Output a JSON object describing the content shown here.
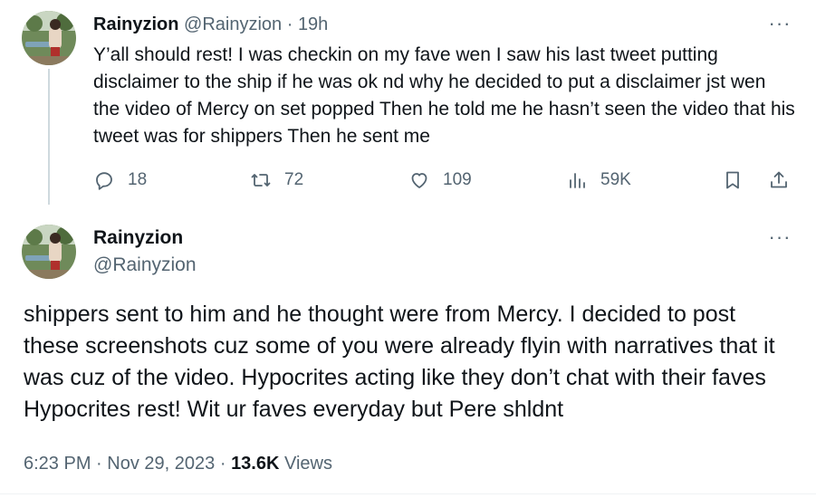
{
  "parent_tweet": {
    "display_name": "Rainyzion",
    "handle": "@Rainyzion",
    "separator": "·",
    "time": "19h",
    "text": "Y’all should rest! I was checkin on my fave wen I saw his last tweet putting disclaimer to the ship if he was ok nd why he decided to put a disclaimer jst wen the video of Mercy on set popped Then he told me he hasn’t seen the video that his tweet was for shippers Then he sent me",
    "actions": {
      "replies": "18",
      "retweets": "72",
      "likes": "109",
      "views": "59K"
    },
    "more_label": "···"
  },
  "main_tweet": {
    "display_name": "Rainyzion",
    "handle": "@Rainyzion",
    "more_label": "···",
    "text": "shippers sent to him and he thought were from Mercy. I decided to post these screenshots cuz some of you were already flyin with narratives that it was cuz of the video. Hypocrites acting like they don’t chat with their faves Hypocrites rest! Wit ur faves everyday but Pere shldnt",
    "time": "6:23 PM",
    "dot": "·",
    "date": "Nov 29, 2023",
    "dot2": "·",
    "views_count": "13.6K",
    "views_label": "Views"
  },
  "icons": [
    "reply-icon",
    "retweet-icon",
    "like-icon",
    "views-icon",
    "bookmark-icon",
    "share-icon",
    "more-icon"
  ],
  "colors": {
    "text": "#0f1419",
    "muted": "#536471",
    "thread_line": "#cfd9de"
  }
}
